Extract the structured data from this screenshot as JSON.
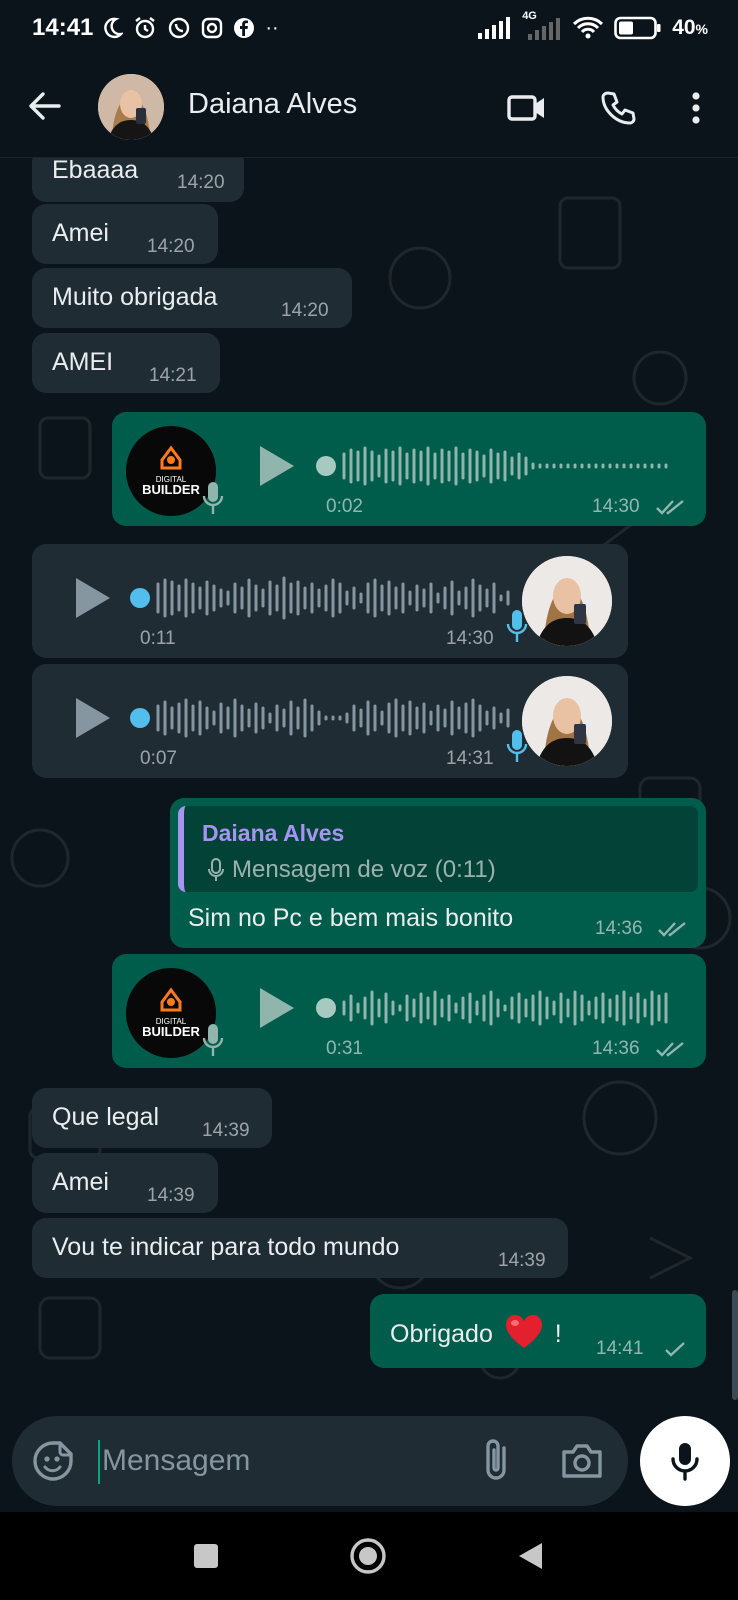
{
  "status_bar": {
    "time": "14:41",
    "network": "4G",
    "battery": "40",
    "battery_suffix": "%"
  },
  "header": {
    "contact_name": "Daiana Alves",
    "icons": [
      "back-arrow-icon",
      "video-call-icon",
      "phone-call-icon",
      "more-options-icon"
    ]
  },
  "messages": [
    {
      "dir": "in",
      "text": "Ebaaaa",
      "time": "14:20"
    },
    {
      "dir": "in",
      "text": "Amei",
      "time": "14:20"
    },
    {
      "dir": "in",
      "text": "Muito obrigada",
      "time": "14:20"
    },
    {
      "dir": "in",
      "text": "AMEI",
      "time": "14:21"
    },
    {
      "dir": "out",
      "type": "voice",
      "duration": "0:02",
      "time": "14:30",
      "status": "read",
      "avatar_text_top": "DIGITAL",
      "avatar_text_bottom": "BUILDER"
    },
    {
      "dir": "in",
      "type": "voice",
      "duration": "0:11",
      "time": "14:30"
    },
    {
      "dir": "in",
      "type": "voice",
      "duration": "0:07",
      "time": "14:31"
    },
    {
      "dir": "out",
      "type": "reply",
      "quote_name": "Daiana Alves",
      "quote_text": "Mensagem de voz (0:11)",
      "text": "Sim no Pc e bem mais bonito",
      "time": "14:36",
      "status": "read"
    },
    {
      "dir": "out",
      "type": "voice",
      "duration": "0:31",
      "time": "14:36",
      "status": "read",
      "avatar_text_top": "DIGITAL",
      "avatar_text_bottom": "BUILDER"
    },
    {
      "dir": "in",
      "text": "Que legal",
      "time": "14:39"
    },
    {
      "dir": "in",
      "text": "Amei",
      "time": "14:39"
    },
    {
      "dir": "in",
      "text": "Vou te indicar para todo mundo",
      "time": "14:39"
    },
    {
      "dir": "out",
      "text": "Obrigado",
      "text_after": "!",
      "emoji": "❤️",
      "time": "14:41",
      "status": "sent"
    }
  ],
  "input": {
    "placeholder": "Mensagem"
  },
  "colors": {
    "background": "#0b141a",
    "incoming_bubble": "#1f2c34",
    "outgoing_bubble": "#005c4b",
    "accent": "#00a884",
    "voice_dot_incoming": "#53bdeb",
    "quote_name": "#a794f0"
  }
}
